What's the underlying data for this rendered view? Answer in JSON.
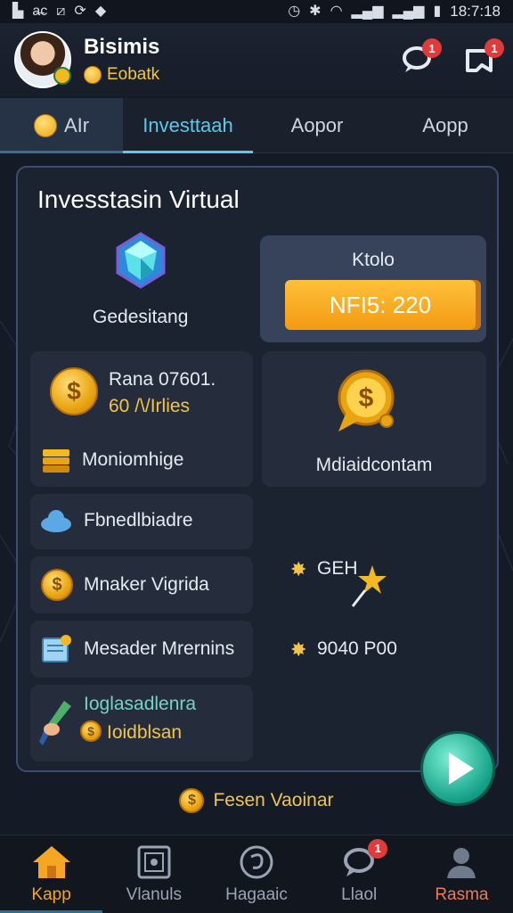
{
  "status_bar": {
    "time": "18:7:18"
  },
  "profile": {
    "name": "Bisimis",
    "subtitle": "Eobatk"
  },
  "header": {
    "notif_chat": "1",
    "notif_share": "1"
  },
  "tabs": [
    {
      "label": "AIr"
    },
    {
      "label": "Investtaah"
    },
    {
      "label": "Aopor"
    },
    {
      "label": "Aopp"
    }
  ],
  "panel": {
    "title": "Invesstasin Virtual",
    "gem_label": "Gedesitang",
    "kolo": {
      "label": "Ktolo",
      "price": "NFI5: 220"
    },
    "card_reward": {
      "line1": "Rana 07601.",
      "line2": "60 /\\/Irlies",
      "action": "Moniomhige"
    },
    "card_chat": {
      "label": "Mdiaidcontam"
    },
    "list": [
      {
        "label": "Fbnedlbiadre",
        "icon": "cloud-icon"
      },
      {
        "label": "Mnaker Vigrida",
        "icon": "coin-icon"
      },
      {
        "label": "Mesader Mrernins",
        "icon": "document-icon"
      }
    ],
    "promo": {
      "line1": "Ioglasadlenra",
      "line2": "Ioidblsan"
    },
    "stat1": {
      "label": "GEH"
    },
    "stat2": {
      "label": "9040 P00"
    },
    "footer_link": "Fesen Vaoinar"
  },
  "bottom_nav": [
    {
      "label": "Kapp",
      "icon": "home-icon",
      "active": true
    },
    {
      "label": "Vlanuls",
      "icon": "image-icon"
    },
    {
      "label": "Hagaaic",
      "icon": "swirl-icon"
    },
    {
      "label": "Llaol",
      "icon": "chat-icon",
      "badge": "1"
    },
    {
      "label": "Rasma",
      "icon": "person-icon"
    }
  ],
  "colors": {
    "accent": "#5cc8ea",
    "gold": "#f4c544",
    "active_nav": "#f5a623",
    "button": "#f39a12"
  }
}
